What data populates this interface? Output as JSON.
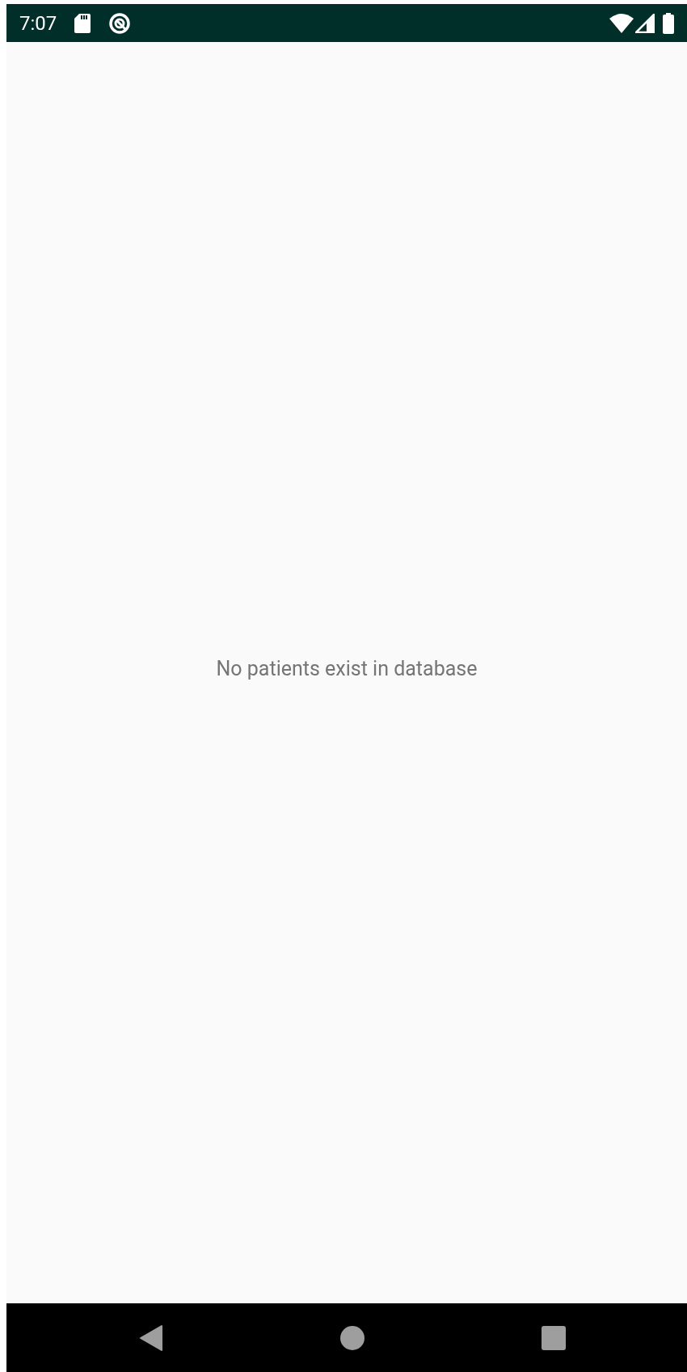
{
  "status_bar": {
    "time": "7:07"
  },
  "empty_message": "No patients exist in database"
}
